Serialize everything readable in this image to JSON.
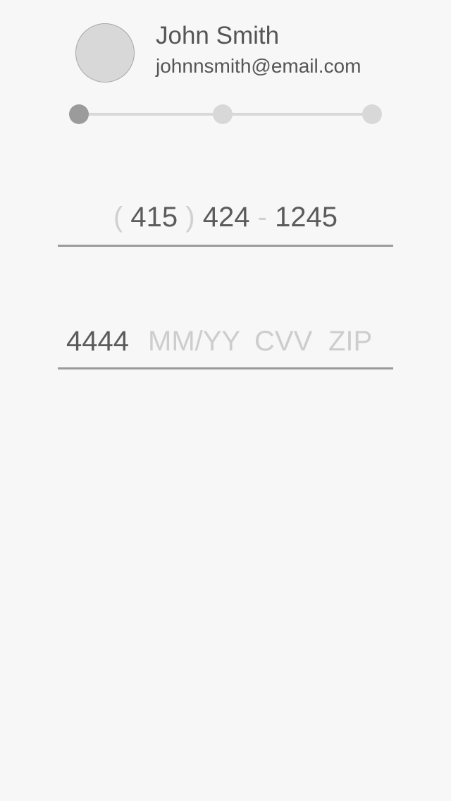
{
  "user": {
    "name": "John Smith",
    "email": "johnnsmith@email.com"
  },
  "progress": {
    "total_steps": 3,
    "current_step": 1
  },
  "phone": {
    "open_paren": "(",
    "area_code": "415",
    "close_paren": ")",
    "prefix": "424",
    "separator": "-",
    "line_number": "1245"
  },
  "card": {
    "number": "4444",
    "expiry_placeholder": "MM/YY",
    "cvv_placeholder": "CVV",
    "zip_placeholder": "ZIP"
  },
  "colors": {
    "background": "#f7f7f7",
    "text": "#555555",
    "placeholder": "#cdcdcd",
    "underline": "#9b9b9b",
    "step_active": "#9b9b9b",
    "step_inactive": "#d8d8d8"
  }
}
